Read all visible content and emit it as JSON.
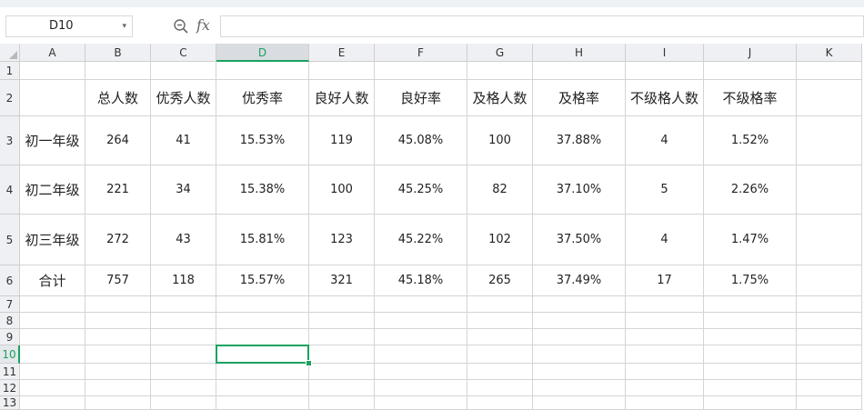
{
  "formula_bar": {
    "name_box": "D10",
    "fx_label": "fx",
    "formula_value": ""
  },
  "columns": [
    "A",
    "B",
    "C",
    "D",
    "E",
    "F",
    "G",
    "H",
    "I",
    "J",
    "K"
  ],
  "rows": [
    "1",
    "2",
    "3",
    "4",
    "5",
    "6",
    "7",
    "8",
    "9",
    "10",
    "11",
    "12",
    "13"
  ],
  "selected": {
    "column": "D",
    "row": "10"
  },
  "table": {
    "header": [
      "",
      "总人数",
      "优秀人数",
      "优秀率",
      "良好人数",
      "良好率",
      "及格人数",
      "及格率",
      "不级格人数",
      "不级格率"
    ],
    "body": [
      [
        "初一年级",
        "264",
        "41",
        "15.53%",
        "119",
        "45.08%",
        "100",
        "37.88%",
        "4",
        "1.52%"
      ],
      [
        "初二年级",
        "221",
        "34",
        "15.38%",
        "100",
        "45.25%",
        "82",
        "37.10%",
        "5",
        "2.26%"
      ],
      [
        "初三年级",
        "272",
        "43",
        "15.81%",
        "123",
        "45.22%",
        "102",
        "37.50%",
        "4",
        "1.47%"
      ],
      [
        "合计",
        "757",
        "118",
        "15.57%",
        "321",
        "45.18%",
        "265",
        "37.49%",
        "17",
        "1.75%"
      ]
    ]
  },
  "colors": {
    "selection": "#1aa260",
    "header_bg": "#eef0f3",
    "gridline": "#d4d4d4"
  }
}
